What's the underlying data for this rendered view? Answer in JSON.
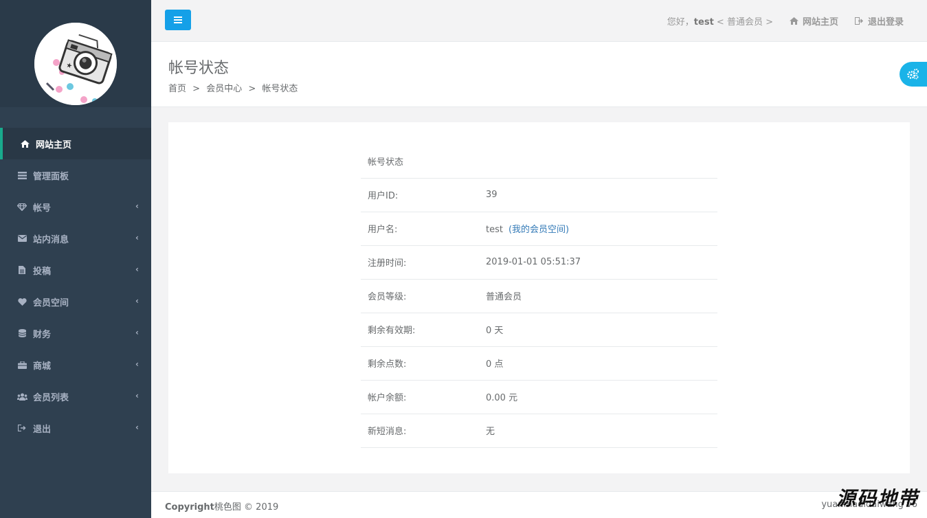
{
  "sidebar": {
    "items": [
      {
        "label": "网站主页",
        "icon": "home-icon",
        "active": true
      },
      {
        "label": "管理面板",
        "icon": "list-icon"
      },
      {
        "label": "帐号",
        "icon": "diamond-icon",
        "chevron": "‹"
      },
      {
        "label": "站内消息",
        "icon": "envelope-icon",
        "chevron": "‹"
      },
      {
        "label": "投稿",
        "icon": "file-icon",
        "chevron": "‹"
      },
      {
        "label": "会员空间",
        "icon": "heart-icon",
        "chevron": "‹"
      },
      {
        "label": "财务",
        "icon": "database-icon",
        "chevron": "‹"
      },
      {
        "label": "商城",
        "icon": "briefcase-icon",
        "chevron": "‹"
      },
      {
        "label": "会员列表",
        "icon": "users-icon",
        "chevron": "‹"
      },
      {
        "label": "退出",
        "icon": "sign-out-icon",
        "chevron": "‹"
      }
    ]
  },
  "topbar": {
    "greeting_prefix": "您好，",
    "username": "test",
    "member_level": " < 普通会员 >",
    "home_link": "网站主页",
    "logout_link": "退出登录"
  },
  "heading": {
    "title": "帐号状态",
    "breadcrumb": [
      "首页",
      "会员中心",
      "帐号状态"
    ],
    "separator": ">"
  },
  "status": {
    "header": "帐号状态",
    "rows": [
      {
        "key": "用户ID:",
        "value": "39"
      },
      {
        "key": "用户名:",
        "value": "test",
        "link": "(我的会员空间)"
      },
      {
        "key": "注册时间:",
        "value": "2019-01-01 05:51:37"
      },
      {
        "key": "会员等级:",
        "value": "普通会员"
      },
      {
        "key": "剩余有效期:",
        "value": "0 天"
      },
      {
        "key": "剩余点数:",
        "value": "0 点"
      },
      {
        "key": "帐户余额:",
        "value": "0.00 元"
      },
      {
        "key": "新短消息:",
        "value": "无"
      }
    ]
  },
  "footer": {
    "copyright_label": "Copyright",
    "copyright_text": "桃色图 © 2019",
    "right_text": "yuanmadidaiwang v6"
  },
  "watermark": "源码地带",
  "colors": {
    "sidebar_bg": "#2f4050",
    "active_border": "#19aa8d",
    "primary": "#14a0e8",
    "link": "#337ab7"
  }
}
